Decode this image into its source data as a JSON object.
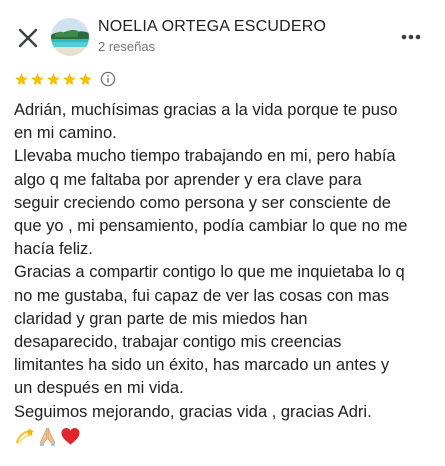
{
  "header": {
    "close_icon": "close-icon",
    "reviewer_name": "NOELIA ORTEGA ESCUDERO",
    "reviewer_meta": "2 reseñas",
    "more_icon": "more-vertical-dots-icon"
  },
  "review": {
    "rating": 5,
    "rating_max": 5,
    "star_color": "#fbbc04",
    "info_icon": "info-icon",
    "lines": [
      "Adrián, muchísimas gracias a la vida porque te puso",
      "en mi camino.",
      "Llevaba mucho tiempo trabajando en mi, pero había",
      "algo q me faltaba por aprender y era clave para",
      "seguir creciendo como persona y  ser consciente de",
      "que yo , mi pensamiento, podía cambiar lo que no me",
      "hacía feliz.",
      "Gracias a compartir contigo lo que me inquietaba lo q",
      "no me gustaba, fui capaz de ver las cosas con mas",
      "claridad y gran parte de mis miedos han",
      "desaparecido, trabajar contigo mis creencias",
      "limitantes ha sido un éxito, has marcado un antes y",
      "un después en mi vida.",
      "Seguimos mejorando, gracias vida , gracias Adri."
    ],
    "emojis": [
      "dizzy-emoji",
      "folded-hands-emoji",
      "red-heart-emoji"
    ]
  }
}
